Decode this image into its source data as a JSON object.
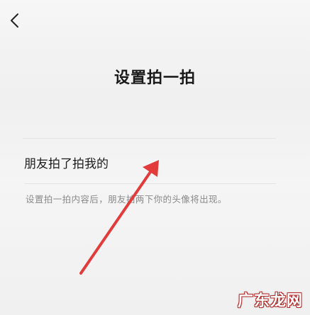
{
  "header": {
    "back_icon": "chevron-left-icon",
    "title": "设置拍一拍"
  },
  "setting": {
    "label": "朋友拍了拍我的",
    "helper": "设置拍一拍内容后，朋友拍两下你的头像将出现。"
  },
  "annotation": {
    "arrow_color": "#e23b3b"
  },
  "watermark": {
    "text": "广东龙网"
  },
  "colors": {
    "background": "#f3f3f3",
    "title": "#1a1a1a",
    "helper": "#8a8a8a"
  }
}
